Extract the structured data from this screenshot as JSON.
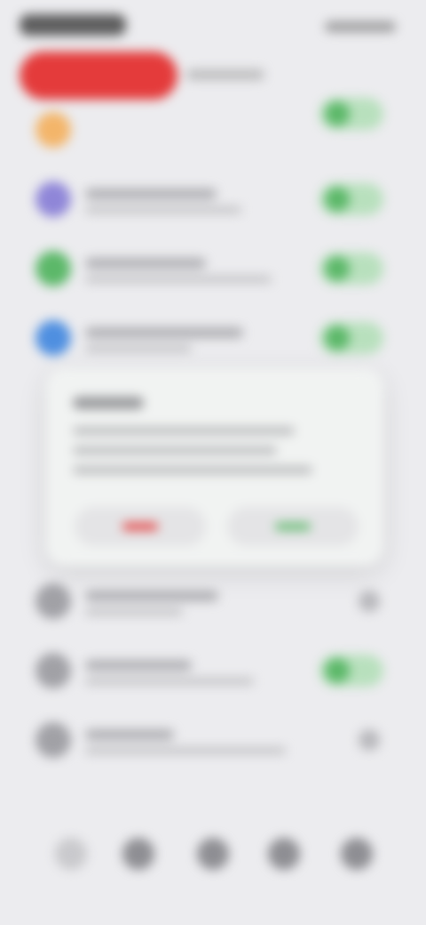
{
  "screen": {
    "background": "#ececef",
    "accent_red": "#e43b3b",
    "accent_green": "#5cb869"
  },
  "header": {
    "banner_icon": "red-pill-banner"
  },
  "list_rows": [
    {
      "icon": "orange-circle-icon",
      "icon_color": "#f3b56a",
      "control": "toggle-on"
    },
    {
      "icon": "purple-circle-icon",
      "icon_color": "#8f86d8",
      "control": "toggle-on"
    },
    {
      "icon": "green-circle-icon",
      "icon_color": "#5cb869",
      "control": "toggle-on"
    },
    {
      "icon": "blue-circle-icon",
      "icon_color": "#4f8fe0",
      "control": "toggle-on"
    },
    {
      "icon": "gray-circle-icon",
      "icon_color": "#a1a1a6",
      "control": "chevron"
    },
    {
      "icon": "gray-circle-icon",
      "icon_color": "#a1a1a6",
      "control": "toggle-on"
    },
    {
      "icon": "gray-circle-icon",
      "icon_color": "#a1a1a6",
      "control": "chevron"
    }
  ],
  "dialog": {
    "cancel_button_color": "#e43b3b",
    "confirm_button_color": "#5cb869"
  },
  "bottom_nav": {
    "icons": [
      "nav-icon-1",
      "nav-icon-2",
      "nav-icon-3",
      "nav-icon-4",
      "nav-icon-5"
    ]
  }
}
